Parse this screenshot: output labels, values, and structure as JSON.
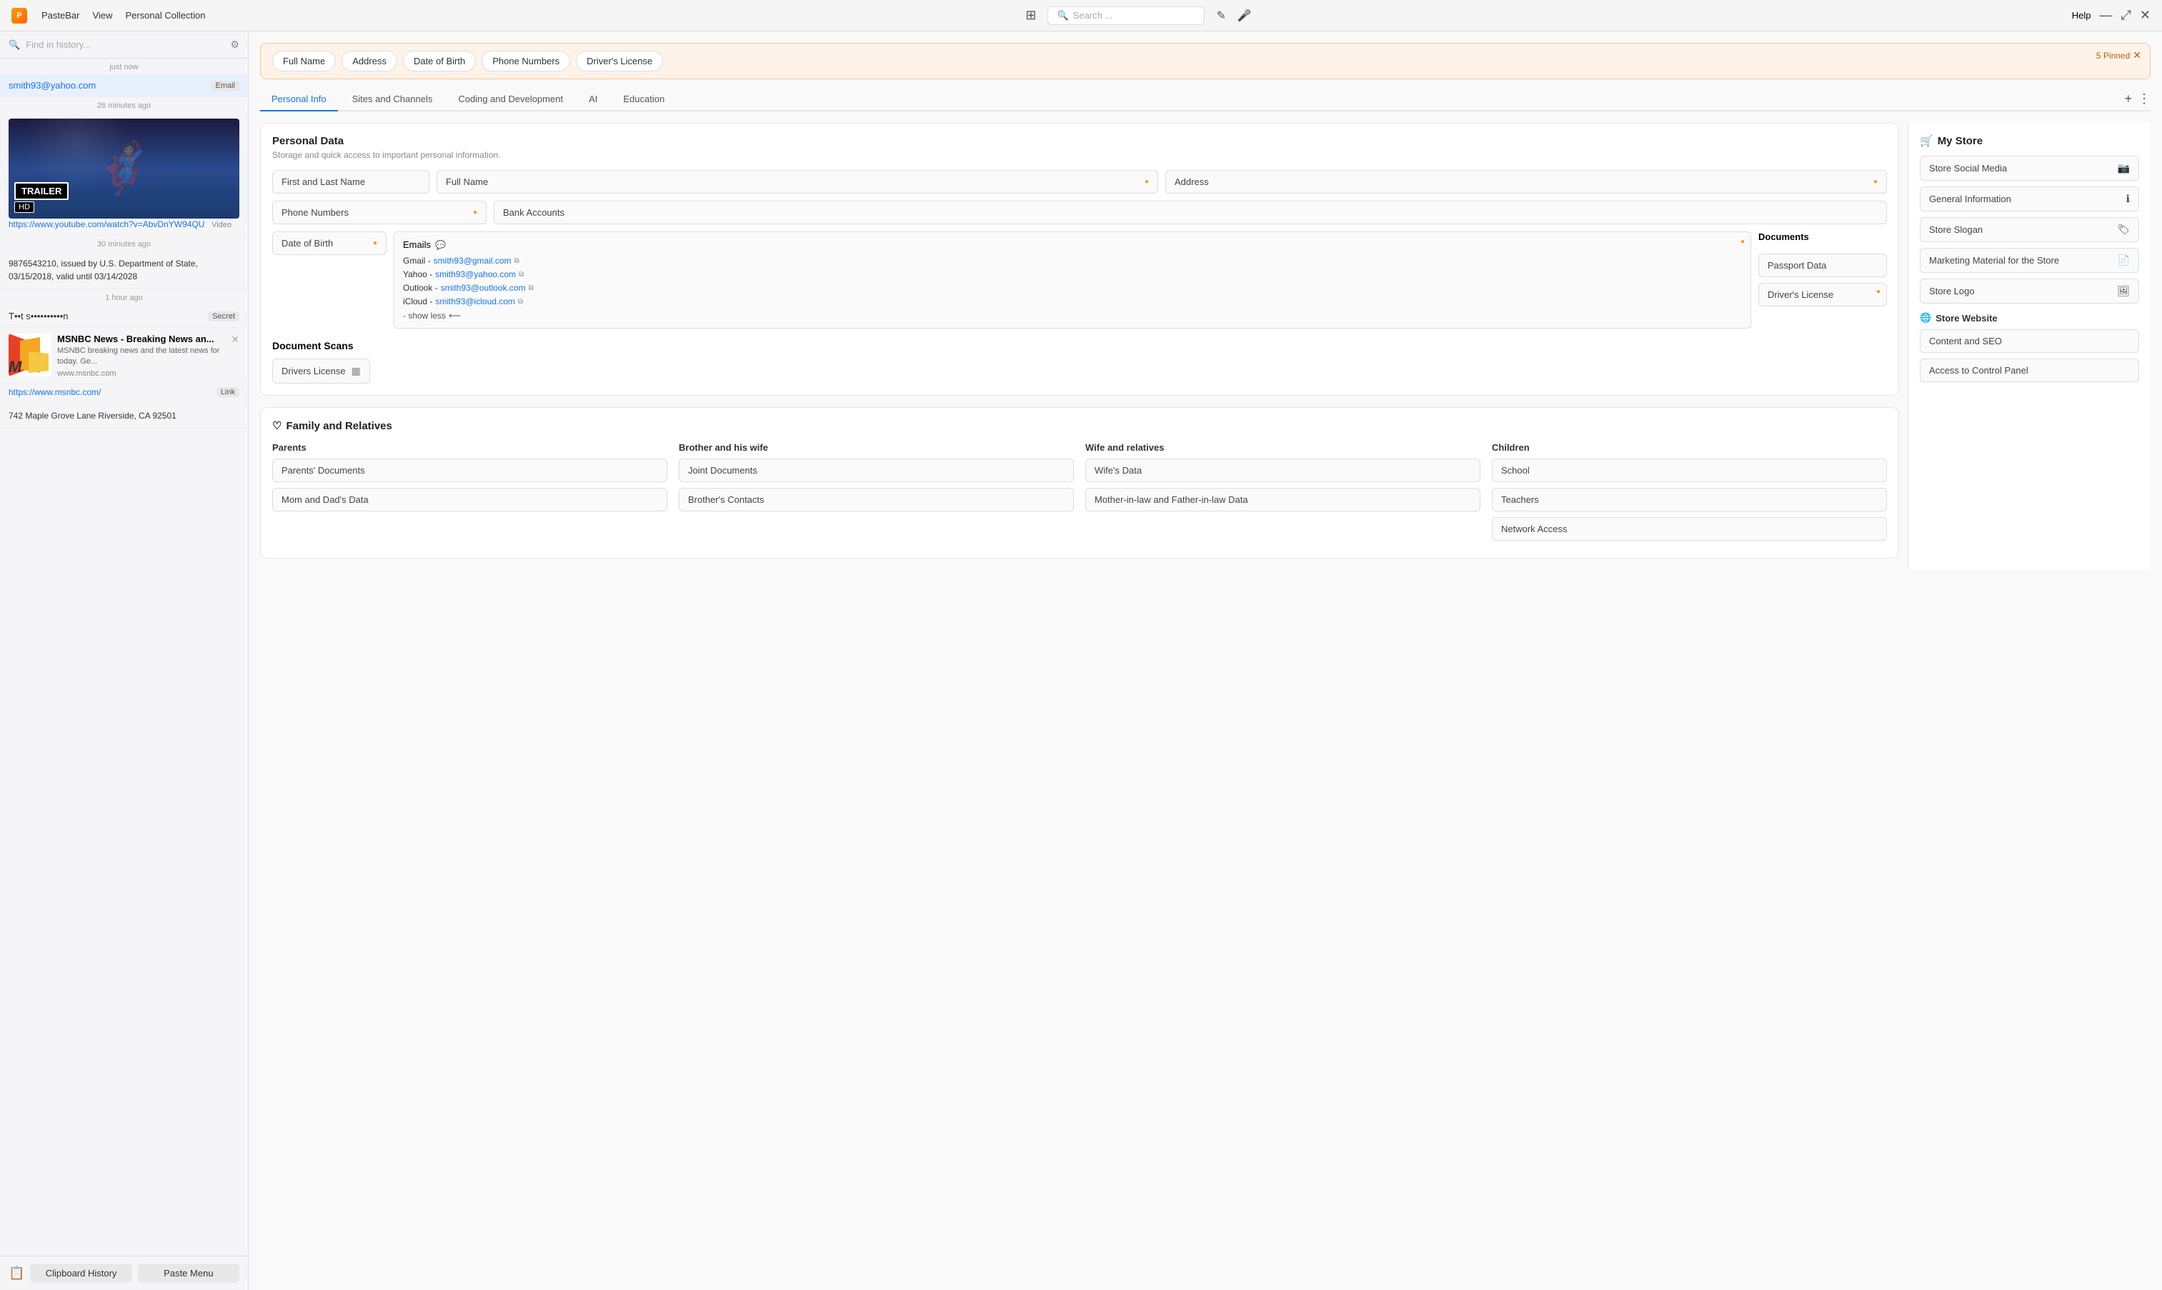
{
  "app": {
    "name": "PasteBar",
    "view_label": "View",
    "collection_label": "Personal Collection",
    "search_placeholder": "Search ...",
    "help_label": "Help"
  },
  "sidebar": {
    "search_placeholder": "Find in history...",
    "items": [
      {
        "timestamp": "just now",
        "type": "email",
        "text": "smith93@yahoo.com",
        "badge": "Email"
      },
      {
        "timestamp": "26 minutes ago",
        "type": "video",
        "url": "https://www.youtube.com/watch?v=AbvDnYW94QU",
        "badge": "Video",
        "trailer_text": "TRAILER",
        "hd_text": "HD"
      },
      {
        "timestamp": "30 minutes ago",
        "type": "text",
        "text": "9876543210, issued by U.S. Department of State, 03/15/2018, valid until 03/14/2028"
      },
      {
        "timestamp": "1 hour ago",
        "type": "secret",
        "text": "T••t s••••••••••n",
        "badge": "Secret"
      },
      {
        "type": "link",
        "msnbc_title": "MSNBC News - Breaking News an...",
        "msnbc_desc": "MSNBC breaking news and the latest news for today. Ge...",
        "msnbc_url": "www.msnbc.com",
        "url": "https://www.msnbc.com/",
        "badge": "Link"
      },
      {
        "type": "address",
        "text": "742 Maple Grove Lane Riverside, CA 92501"
      }
    ],
    "bottom": {
      "icon_label": "clipboard",
      "history_btn": "Clipboard History",
      "paste_btn": "Paste Menu"
    }
  },
  "pinned": {
    "count_label": "5 Pinned",
    "tags": [
      "Full Name",
      "Address",
      "Date of Birth",
      "Phone Numbers",
      "Driver's License"
    ]
  },
  "tabs": [
    {
      "label": "Personal Info",
      "active": true
    },
    {
      "label": "Sites and Channels",
      "active": false
    },
    {
      "label": "Coding and Development",
      "active": false
    },
    {
      "label": "AI",
      "active": false
    },
    {
      "label": "Education",
      "active": false
    }
  ],
  "personal_data": {
    "section_title": "Personal Data",
    "section_subtitle": "Storage and quick access to important personal information.",
    "fields": {
      "first_last_name": "First and Last Name",
      "full_name": "Full Name",
      "address": "Address",
      "phone_numbers": "Phone Numbers",
      "bank_accounts": "Bank Accounts",
      "date_of_birth": "Date of Birth"
    },
    "emails": {
      "title": "Emails",
      "gmail_label": "Gmail -",
      "gmail_value": "smith93@gmail.com",
      "yahoo_label": "Yahoo -",
      "yahoo_value": "smith93@yahoo.com",
      "outlook_label": "Outlook -",
      "outlook_value": "smith93@outlook.com",
      "icloud_label": "iCloud -",
      "icloud_value": "smith93@icloud.com",
      "show_less": "- show less"
    },
    "documents": {
      "title": "Documents",
      "passport": "Passport Data",
      "drivers_license": "Driver's License"
    },
    "document_scans": {
      "title": "Document Scans",
      "drivers_license": "Drivers License"
    }
  },
  "family": {
    "title": "Family and Relatives",
    "parents": {
      "title": "Parents",
      "items": [
        "Parents' Documents",
        "Mom and Dad's Data"
      ]
    },
    "brother": {
      "title": "Brother and his wife",
      "items": [
        "Joint Documents",
        "Brother's Contacts"
      ]
    },
    "wife": {
      "title": "Wife and relatives",
      "items": [
        "Wife's Data",
        "Mother-in-law and Father-in-law Data"
      ]
    },
    "children": {
      "title": "Children",
      "items": [
        "School",
        "Teachers",
        "Network Access"
      ]
    }
  },
  "right_panel": {
    "my_store_title": "My Store",
    "items": [
      {
        "label": "Store Social Media",
        "icon": "instagram"
      },
      {
        "label": "General Information",
        "icon": "info"
      },
      {
        "label": "Store Slogan",
        "icon": "tag"
      },
      {
        "label": "Marketing Material for the Store",
        "icon": "document"
      },
      {
        "label": "Store Logo",
        "icon": "image"
      }
    ],
    "store_website": {
      "title": "Store Website",
      "items": [
        "Content and SEO",
        "Access to Control Panel"
      ]
    }
  }
}
